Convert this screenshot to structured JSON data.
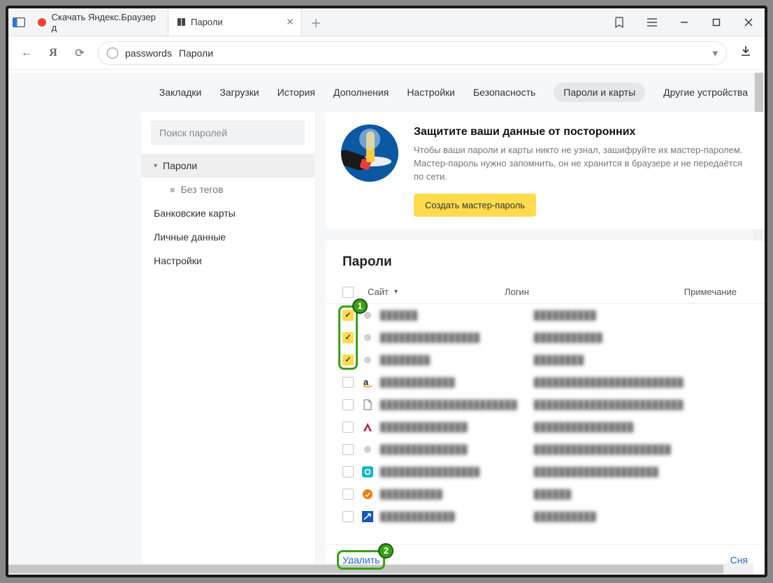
{
  "window": {
    "tab1_title": "Скачать Яндекс.Браузер д",
    "tab2_title": "Пароли"
  },
  "addressbar": {
    "path": "passwords",
    "label": "Пароли"
  },
  "topnav": {
    "bookmarks": "Закладки",
    "downloads": "Загрузки",
    "history": "История",
    "addons": "Дополнения",
    "settings": "Настройки",
    "security": "Безопасность",
    "passwords_cards": "Пароли и карты",
    "other_devices": "Другие устройства"
  },
  "sidebar": {
    "search_placeholder": "Поиск паролей",
    "passwords": "Пароли",
    "no_tags": "Без тегов",
    "bank_cards": "Банковские карты",
    "personal_data": "Личные данные",
    "settings": "Настройки"
  },
  "banner": {
    "heading": "Защитите ваши данные от посторонних",
    "body": "Чтобы ваши пароли и карты никто не узнал, зашифруйте их мастер-паролем. Мастер-пароль нужно запомнить, он не хранится в браузере и не передаётся по сети.",
    "button": "Создать мастер-пароль"
  },
  "table": {
    "title": "Пароли",
    "col_site": "Сайт",
    "col_login": "Логин",
    "col_note": "Примечание",
    "rows": [
      {
        "checked": true,
        "icon": "dot-gray",
        "site": "██████",
        "login": "██████████"
      },
      {
        "checked": true,
        "icon": "dot-gray",
        "site": "████████████████",
        "login": "███████████"
      },
      {
        "checked": true,
        "icon": "dot-gray",
        "site": "████████",
        "login": "████████"
      },
      {
        "checked": false,
        "icon": "amazon",
        "site": "████████████",
        "login": "████████████████████████"
      },
      {
        "checked": false,
        "icon": "file",
        "site": "██████████████████████",
        "login": "████████████████████████"
      },
      {
        "checked": false,
        "icon": "adobe",
        "site": "██████████████",
        "login": "████████████████"
      },
      {
        "checked": false,
        "icon": "dot-gray",
        "site": "██████████████",
        "login": "██████████████████████"
      },
      {
        "checked": false,
        "icon": "teal",
        "site": "████████████████",
        "login": "████████████████████"
      },
      {
        "checked": false,
        "icon": "avast",
        "site": "██████████",
        "login": "██████"
      },
      {
        "checked": false,
        "icon": "blue",
        "site": "████████████",
        "login": "██████████"
      }
    ]
  },
  "footer": {
    "delete": "Удалить",
    "deselect": "Сня"
  },
  "annotation": {
    "badge1": "1",
    "badge2": "2"
  }
}
